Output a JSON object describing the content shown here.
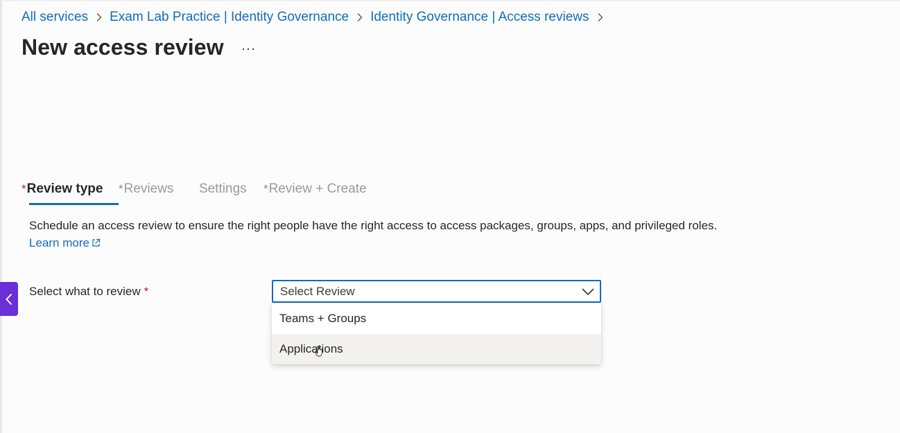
{
  "breadcrumb": {
    "items": [
      {
        "label": "All services"
      },
      {
        "label": "Exam Lab Practice | Identity Governance"
      },
      {
        "label": "Identity Governance | Access reviews"
      }
    ]
  },
  "page": {
    "title": "New access review",
    "more_label": "···"
  },
  "tabs": [
    {
      "label": "Review type",
      "required": "*",
      "active": true
    },
    {
      "label": "Reviews",
      "required": "*",
      "active": false
    },
    {
      "label": "Settings",
      "required": "",
      "active": false
    },
    {
      "label": "Review + Create",
      "required": "*",
      "active": false
    }
  ],
  "description": {
    "text": "Schedule an access review to ensure the right people have the right access to access packages, groups, apps, and privileged roles.",
    "learn_more": "Learn more"
  },
  "review_field": {
    "label": "Select what to review",
    "required": "*",
    "placeholder": "Select Review",
    "options": [
      {
        "label": "Teams + Groups"
      },
      {
        "label": "Applications"
      }
    ],
    "hovered_option": "Applications"
  },
  "icons": {
    "breadcrumb_separator": "chevron-right-icon",
    "select_chevron": "chevron-down-icon",
    "external_link": "external-link-icon",
    "collapse": "chevron-left-icon",
    "cursor": "hand-pointer-icon"
  },
  "colors": {
    "link": "#0f6cbd",
    "accent_underline": "#0f6cbd",
    "required": "#a4262c",
    "collapse_button": "#6a2fd6",
    "option_hover": "#f2f1f0"
  }
}
